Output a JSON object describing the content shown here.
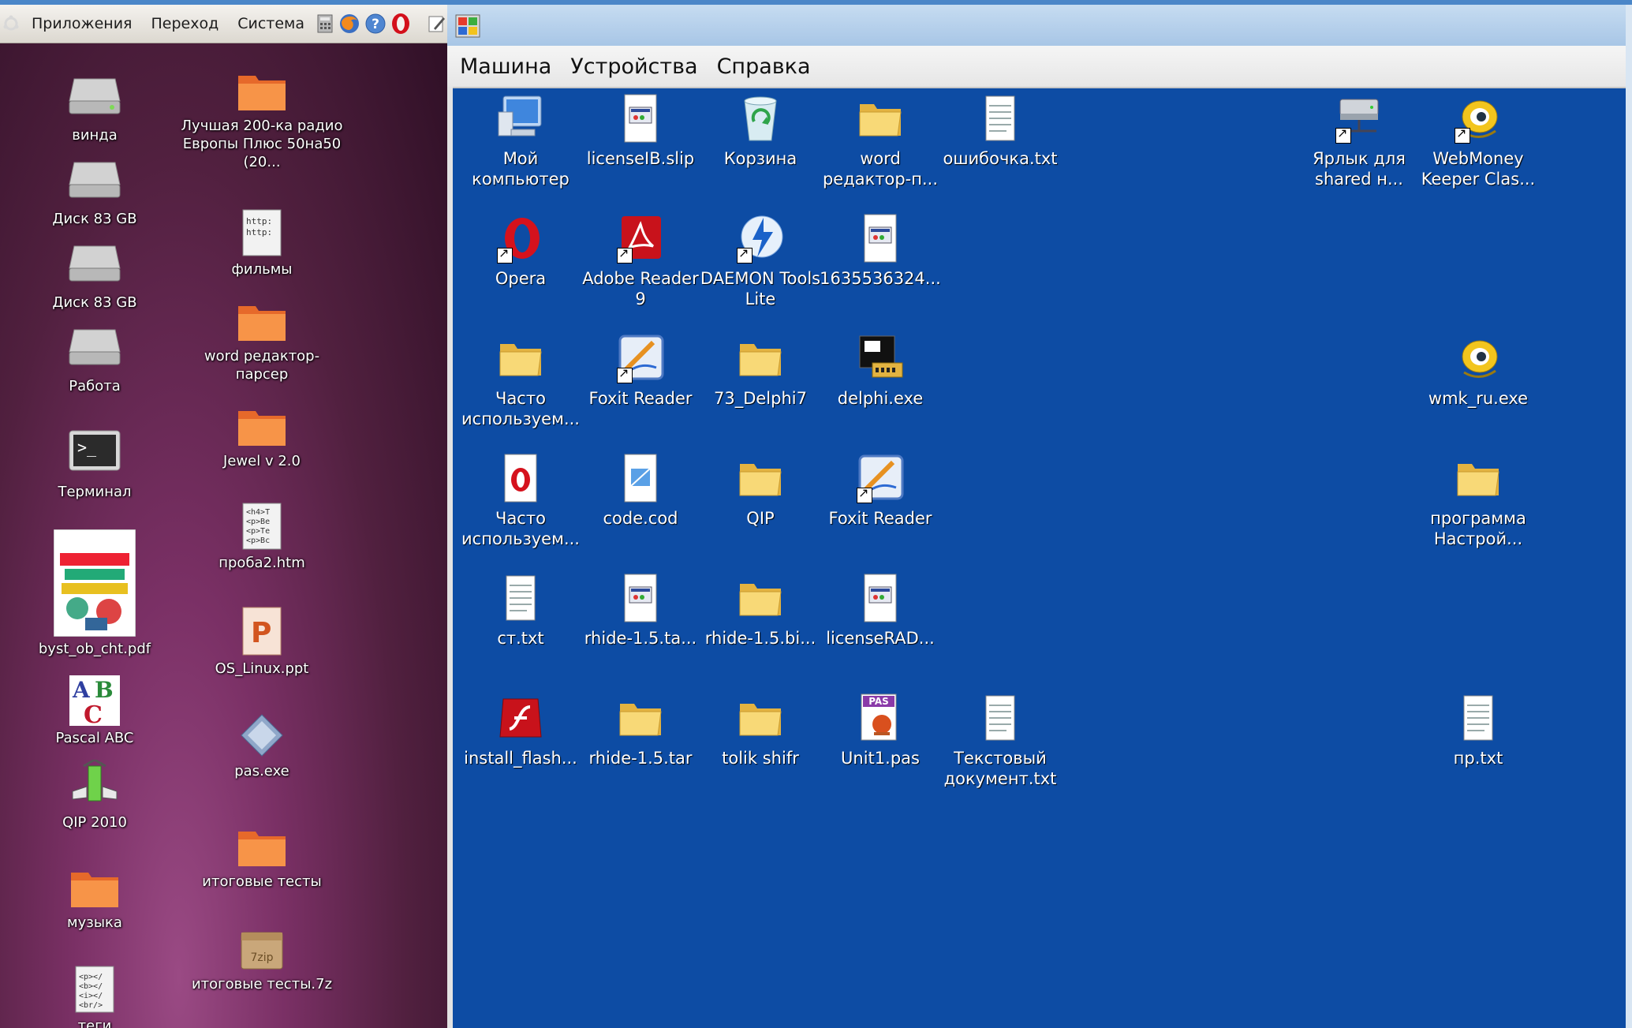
{
  "ubuntu": {
    "panel_menu": [
      "Приложения",
      "Переход",
      "Система"
    ],
    "icons_col1": [
      "винда",
      "Диск 83 GB",
      "Диск 83 GB",
      "Работа",
      "Терминал",
      "byst_ob_cht.pdf",
      "Pascal ABC",
      "QIP 2010",
      "музыка",
      "теги"
    ],
    "icons_col2": [
      "Лучшая 200-ка радио Европы Плюс 50на50 (20...",
      "фильмы",
      "word редактор-парсер",
      "Jewel v 2.0",
      "проба2.htm",
      "OS_Linux.ppt",
      "pas.exe",
      "итоговые тесты",
      "итоговые тесты.7z"
    ]
  },
  "vbox": {
    "menu": [
      "Машина",
      "Устройства",
      "Справка"
    ]
  },
  "guest_icons": {
    "mycomputer": "Мой компьютер",
    "licenseib": "licenseIB.slip",
    "recycle": "Корзина",
    "word_editor": "word редактор-п...",
    "oshibochka": "ошибочка.txt",
    "shared_link": "Ярлык для shared н...",
    "webmoney": "WebMoney Keeper Clas...",
    "opera": "Opera",
    "adobe": "Adobe Reader 9",
    "daemon": "DAEMON Tools Lite",
    "num_file": "1635536324...",
    "chasto1": "Часто используем...",
    "foxit1": "Foxit Reader",
    "delphi7": "73_Delphi7",
    "delphi_exe": "delphi.exe",
    "wmk": "wmk_ru.exe",
    "chasto2": "Часто используем...",
    "code_cod": "code.cod",
    "qip": "QIP",
    "foxit2": "Foxit Reader",
    "programma": "программа Настрой...",
    "st_txt": "ст.txt",
    "rhide_ta": "rhide-1.5.ta...",
    "rhide_bi": "rhide-1.5.bi...",
    "licenserad": "licenseRAD...",
    "install_flash": "install_flash...",
    "rhide_tar": "rhide-1.5.tar",
    "tolik": "tolik shifr",
    "unit1": "Unit1.pas",
    "text_doc": "Текстовый документ.txt",
    "np_txt": "пр.txt"
  },
  "icon_labels_small": {
    "pas_badge": "PAS",
    "zip_badge": "7zip",
    "http_text": "http:"
  }
}
